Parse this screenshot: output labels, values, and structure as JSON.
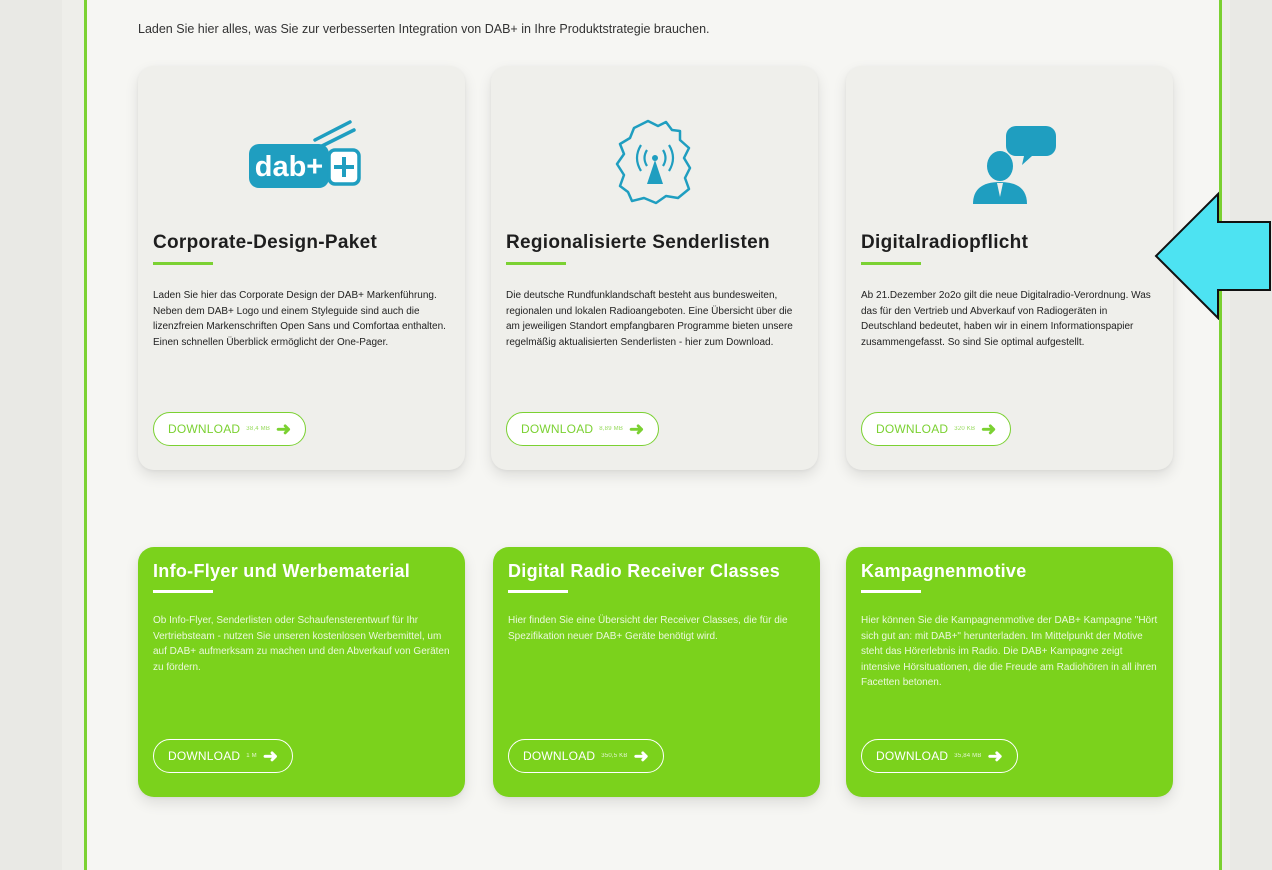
{
  "intro_text": "Laden Sie hier alles, was Sie zur verbesserten Integration von DAB+ in Ihre Produktstrategie brauchen.",
  "colors": {
    "accent_green": "#7bd132",
    "card_green": "#7bd21c",
    "icon_teal": "#1f9ec0",
    "pointer_cyan": "#4de3f2"
  },
  "cards_top": [
    {
      "icon": "dab-logo-icon",
      "logo_text": "dab+",
      "title": "Corporate-Design-Paket",
      "text": "Laden Sie hier das Corporate Design der DAB+ Markenführung. Neben dem DAB+ Logo und einem Styleguide sind auch die lizenzfreien Markenschriften Open Sans und Comfortaa enthalten. Einen schnellen Überblick ermöglicht der One-Pager.",
      "button_label": "DOWNLOAD",
      "size": "38,4 MB"
    },
    {
      "icon": "germany-map-antenna-icon",
      "title": "Regionalisierte Senderlisten",
      "text": "Die deutsche Rundfunklandschaft besteht aus bundesweiten, regionalen und lokalen Radioangeboten. Eine Übersicht über die am jeweiligen Standort empfangbaren Programme bieten unsere regelmäßig aktualisierten Senderlisten - hier zum Download.",
      "button_label": "DOWNLOAD",
      "size": "8,89 MB"
    },
    {
      "icon": "person-speech-bubble-icon",
      "title": "Digitalradiopflicht",
      "text": "Ab 21.Dezember 2o2o gilt die neue Digitalradio-Verordnung. Was das für den Vertrieb und Abverkauf von Radiogeräten in Deutschland bedeutet, haben wir in einem Informationspapier zusammengefasst. So sind Sie optimal aufgestellt.",
      "button_label": "DOWNLOAD",
      "size": "320 KB"
    }
  ],
  "cards_bottom": [
    {
      "title": "Info-Flyer und Werbematerial",
      "text": "Ob Info-Flyer, Senderlisten oder Schaufensterentwurf für Ihr Vertriebsteam - nutzen Sie unseren kostenlosen Werbemittel, um auf DAB+ aufmerksam zu machen und den Abverkauf von Geräten zu fördern.",
      "button_label": "DOWNLOAD",
      "size": "1 M"
    },
    {
      "title": "Digital Radio Receiver Classes",
      "text": "Hier finden Sie eine Übersicht der Receiver Classes, die für die Spezifikation neuer DAB+ Geräte benötigt wird.",
      "button_label": "DOWNLOAD",
      "size": "350,5 KB"
    },
    {
      "title": "Kampagnenmotive",
      "text": "Hier können Sie die Kampagnenmotive der DAB+ Kampagne \"Hört sich gut an: mit DAB+\" herunterladen. Im Mittelpunkt der Motive steht das Hörerlebnis im Radio. Die DAB+ Kampagne zeigt intensive Hörsituationen, die die Freude am Radiohören in all ihren Facetten betonen.",
      "button_label": "DOWNLOAD",
      "size": "35,84 MB"
    }
  ]
}
